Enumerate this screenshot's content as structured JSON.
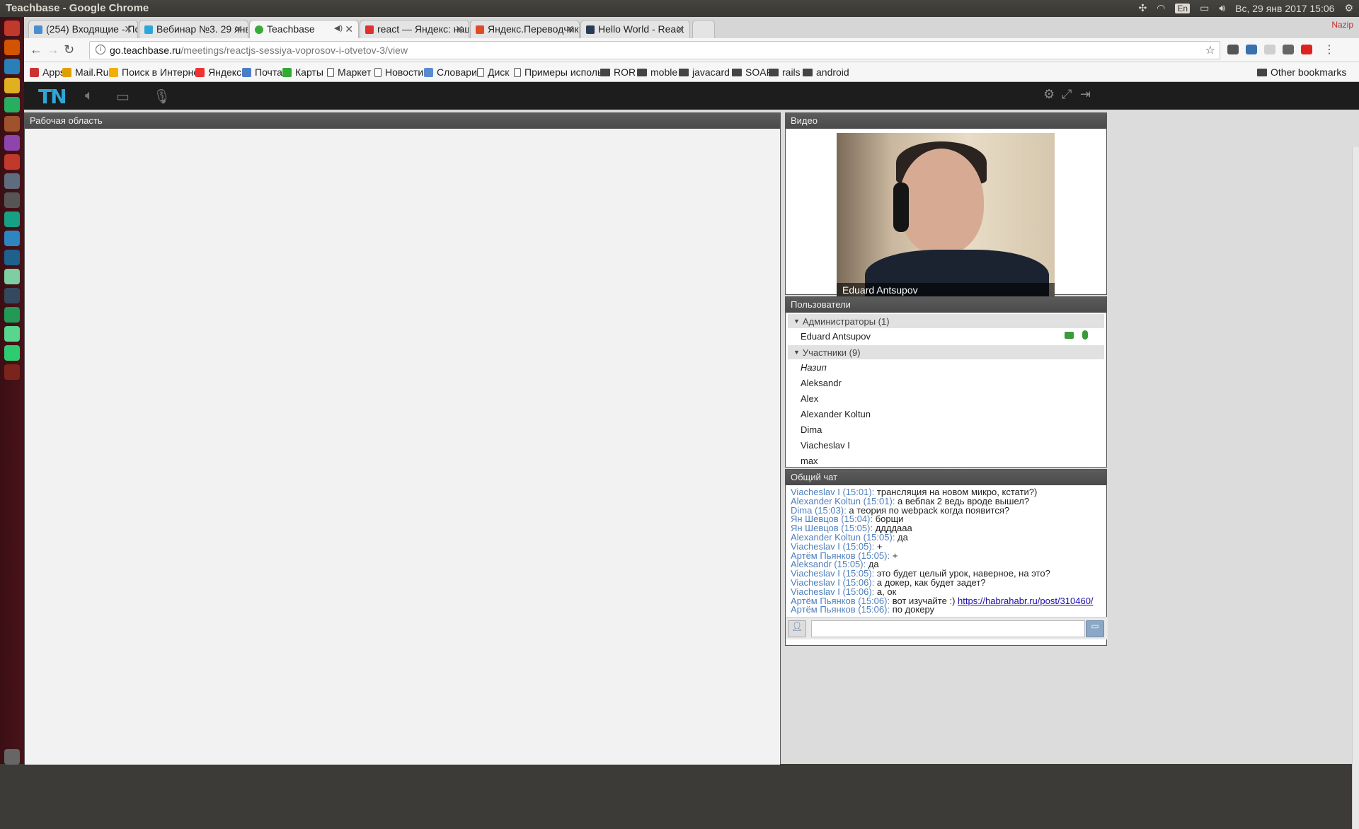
{
  "os": {
    "window_title": "Teachbase - Google Chrome",
    "lang": "En",
    "datetime": "Вс, 29 янв 2017 15:06"
  },
  "tabs": [
    {
      "label": "(254) Входящие - По",
      "fav": "#4a8ed0"
    },
    {
      "label": "Вебинар №3. 29 янв",
      "fav": "#2ea7d8"
    },
    {
      "label": "Teachbase",
      "fav": "#3aaa3a"
    },
    {
      "label": "react — Яндекс: наш",
      "fav": "#e03030"
    },
    {
      "label": "Яндекс.Переводчик",
      "fav": "#e04a2a"
    },
    {
      "label": "Hello World - React",
      "fav": "#2a3b55"
    }
  ],
  "profile": "Nazip",
  "address": {
    "host": "go.teachbase.ru",
    "path": "/meetings/reactjs-sessiya-voprosov-i-otvetov-3/view"
  },
  "bookmarks": [
    {
      "label": "Apps",
      "icon": "apps-icon"
    },
    {
      "label": "Mail.Ru",
      "icon": "mailru-icon"
    },
    {
      "label": "Поиск в Интерне",
      "icon": "search-icon"
    },
    {
      "label": "Яндекс",
      "icon": "yandex-icon"
    },
    {
      "label": "Почта",
      "icon": "mail-icon"
    },
    {
      "label": "Карты",
      "icon": "maps-icon"
    },
    {
      "label": "Маркет",
      "icon": "page-icon"
    },
    {
      "label": "Новости",
      "icon": "page-icon"
    },
    {
      "label": "Словари",
      "icon": "dictionary-icon"
    },
    {
      "label": "Диск",
      "icon": "page-icon"
    },
    {
      "label": "Примеры исполь",
      "icon": "page-icon"
    },
    {
      "label": "ROR",
      "icon": "folder-icon"
    },
    {
      "label": "moble",
      "icon": "folder-icon"
    },
    {
      "label": "javacard",
      "icon": "folder-icon"
    },
    {
      "label": "SOAP",
      "icon": "folder-icon"
    },
    {
      "label": "rails",
      "icon": "folder-icon"
    },
    {
      "label": "android",
      "icon": "folder-icon"
    }
  ],
  "other_bookmarks": "Other bookmarks",
  "app": {
    "logo": "TN",
    "workspace_title": "Рабочая область",
    "video_title": "Видео",
    "video_name": "Eduard Antsupov",
    "users_title": "Пользователи",
    "admins_label": "Администраторы (1)",
    "admins": [
      "Eduard Antsupov"
    ],
    "participants_label": "Участники (9)",
    "participants": [
      "Назип",
      "Aleksandr",
      "Alex",
      "Alexander Koltun",
      "Dima",
      "Viacheslav I",
      "max"
    ],
    "chat_title": "Общий чат",
    "chat": [
      {
        "who": "Viacheslav I  (15:01):",
        "text": " трансляция на новом микро, кстати?)"
      },
      {
        "who": "Alexander Koltun  (15:01):",
        "text": " а вебпак 2 ведь вроде вышел?"
      },
      {
        "who": "Dima  (15:03):",
        "text": " а теория по webpack когда появится?"
      },
      {
        "who": "Ян Шевцов (15:04):",
        "text": " борщи"
      },
      {
        "who": "Ян Шевцов (15:05):",
        "text": " ддддааа"
      },
      {
        "who": "Alexander Koltun  (15:05):",
        "text": " да"
      },
      {
        "who": "Viacheslav I  (15:05):",
        "text": " +"
      },
      {
        "who": "Артём Пьянков (15:05):",
        "text": " +"
      },
      {
        "who": "Aleksandr  (15:05):",
        "text": " да"
      },
      {
        "who": "Viacheslav I  (15:05):",
        "text": " это будет целый урок, наверное, на это?"
      },
      {
        "who": "Viacheslav I  (15:06):",
        "text": " а докер, как будет задет?"
      },
      {
        "who": "Viacheslav I  (15:06):",
        "text": " а, ок"
      },
      {
        "who": "Артём Пьянков (15:06):",
        "text": " вот изучайте :) ",
        "link": "https://habrahabr.ru/post/310460/"
      },
      {
        "who": "Артём Пьянков (15:06):",
        "text": " по докеру"
      }
    ]
  }
}
